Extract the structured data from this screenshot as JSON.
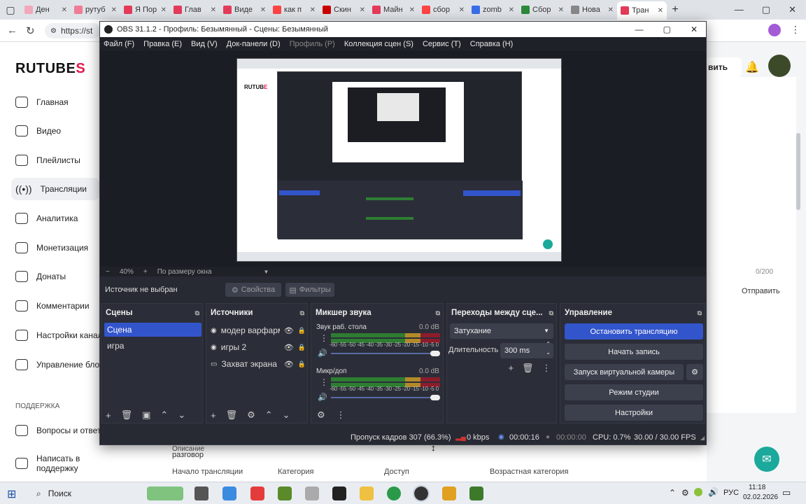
{
  "browser": {
    "tabs": [
      {
        "label": "Ден",
        "color": "#f2a7ba"
      },
      {
        "label": "рутуб",
        "color": "#f07c95"
      },
      {
        "label": "Я Пор",
        "color": "#e53b5a"
      },
      {
        "label": "Глав",
        "color": "#e53b5a"
      },
      {
        "label": "Виде",
        "color": "#e53b5a"
      },
      {
        "label": "как п",
        "color": "#f44"
      },
      {
        "label": "Скин",
        "color": "#c00"
      },
      {
        "label": "Майн",
        "color": "#e53b5a"
      },
      {
        "label": "сбор",
        "color": "#f44"
      },
      {
        "label": "zomb",
        "color": "#3a6ee8"
      },
      {
        "label": "Сбор",
        "color": "#2d8a3a"
      },
      {
        "label": "Нова",
        "color": "#888"
      },
      {
        "label": "Тран",
        "color": "#e53b5a"
      }
    ],
    "address": "https://st"
  },
  "rutube": {
    "logo": "RUTUBE",
    "logo_tail": "S",
    "nav": [
      "Главная",
      "Видео",
      "Плейлисты",
      "Трансляции",
      "Аналитика",
      "Монетизация",
      "Донаты",
      "Комментарии",
      "Настройки канал",
      "Управление блог"
    ],
    "support_header": "ПОДДЕРЖКА",
    "support_items": [
      "Вопросы и ответы",
      "Написать в поддержку"
    ],
    "right_button": "вить",
    "counter": "0/200",
    "send": "Отправить",
    "bottom_text": "разговор",
    "bottom_table": [
      "Начало трансляции",
      "Категория",
      "Доступ",
      "Возрастная категория"
    ],
    "bottom_left": "Описание"
  },
  "obs": {
    "title": "OBS 31.1.2 - Профиль: Безымянный - Сцены: Безымянный",
    "menu": [
      "Файл (F)",
      "Правка (E)",
      "Вид (V)",
      "Док-панели (D)",
      "Профиль (P)",
      "Коллекция сцен (S)",
      "Сервис (T)",
      "Справка (H)"
    ],
    "zoom": "40%",
    "fit": "По размеру окна",
    "source_bar": {
      "no_source": "Источник не выбран",
      "properties": "Свойства",
      "filters": "Фильтры"
    },
    "scenes": {
      "title": "Сцены",
      "items": [
        "Сцена",
        "игра"
      ]
    },
    "sources": {
      "title": "Источники",
      "items": [
        "модер варфарм",
        "игры 2",
        "Захват экрана"
      ]
    },
    "mixer": {
      "title": "Микшер звука",
      "channels": [
        {
          "name": "Звук раб. стола",
          "db": "0.0 dB"
        },
        {
          "name": "Микр/доп",
          "db": "0.0 dB"
        }
      ],
      "scale": "-60 -55 -50 -45 -40 -35 -30 -25 -20 -15 -10 -5 0"
    },
    "transitions": {
      "title": "Переходы между сце...",
      "selected": "Затухание",
      "duration_label": "Длительность",
      "duration": "300 ms"
    },
    "controls": {
      "title": "Управление",
      "stop_stream": "Остановить трансляцию",
      "start_record": "Начать запись",
      "virtual_cam": "Запуск виртуальной камеры",
      "studio_mode": "Режим студии",
      "settings": "Настройки"
    },
    "status": {
      "dropped": "Пропуск кадров 307 (66.3%)",
      "kbps": "0 kbps",
      "stream_time": "00:00:16",
      "rec_time": "00:00:00",
      "cpu": "CPU: 0.7%",
      "fps": "30.00 / 30.00 FPS"
    }
  },
  "taskbar": {
    "search": "Поиск",
    "lang": "РУС",
    "time": "11:18",
    "date": "02.02.2026"
  },
  "colors": {
    "accent": "#3355cc",
    "obs_bg": "#272a33"
  }
}
